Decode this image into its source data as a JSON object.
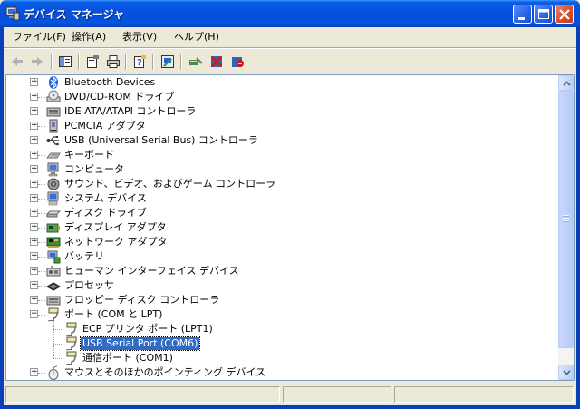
{
  "window": {
    "title": "デバイス マネージャ"
  },
  "menu": {
    "items": [
      "ファイル(F)",
      "操作(A)",
      "表示(V)",
      "ヘルプ(H)"
    ]
  },
  "toolbar": {
    "buttons": [
      "back-icon",
      "forward-icon",
      "show-hide-tree-icon",
      "properties-icon",
      "print-icon",
      "help-icon",
      "update-driver-icon",
      "scan-hardware-icon",
      "disable-device-icon",
      "uninstall-device-icon"
    ]
  },
  "tree": {
    "items": [
      {
        "label": "Bluetooth Devices",
        "icon": "bluetooth-icon",
        "expander": "+"
      },
      {
        "label": "DVD/CD-ROM ドライブ",
        "icon": "cdrom-icon",
        "expander": "+"
      },
      {
        "label": "IDE ATA/ATAPI コントローラ",
        "icon": "ide-controller-icon",
        "expander": "+"
      },
      {
        "label": "PCMCIA アダプタ",
        "icon": "pcmcia-icon",
        "expander": "+"
      },
      {
        "label": "USB (Universal Serial Bus) コントローラ",
        "icon": "usb-icon",
        "expander": "+"
      },
      {
        "label": "キーボード",
        "icon": "keyboard-icon",
        "expander": "+"
      },
      {
        "label": "コンピュータ",
        "icon": "computer-icon",
        "expander": "+"
      },
      {
        "label": "サウンド、ビデオ、およびゲーム コントローラ",
        "icon": "sound-icon",
        "expander": "+"
      },
      {
        "label": "システム デバイス",
        "icon": "system-device-icon",
        "expander": "+"
      },
      {
        "label": "ディスク ドライブ",
        "icon": "disk-drive-icon",
        "expander": "+"
      },
      {
        "label": "ディスプレイ アダプタ",
        "icon": "display-adapter-icon",
        "expander": "+"
      },
      {
        "label": "ネットワーク アダプタ",
        "icon": "network-adapter-icon",
        "expander": "+"
      },
      {
        "label": "バッテリ",
        "icon": "battery-icon",
        "expander": "+"
      },
      {
        "label": "ヒューマン インターフェイス デバイス",
        "icon": "hid-icon",
        "expander": "+"
      },
      {
        "label": "プロセッサ",
        "icon": "processor-icon",
        "expander": "+"
      },
      {
        "label": "フロッピー ディスク コントローラ",
        "icon": "floppy-controller-icon",
        "expander": "+"
      },
      {
        "label": "ポート (COM と LPT)",
        "icon": "port-icon",
        "expander": "−"
      },
      {
        "label": "ECP プリンタ ポート (LPT1)",
        "icon": "port-icon",
        "child": true
      },
      {
        "label": "USB Serial Port (COM6)",
        "icon": "port-icon",
        "child": true,
        "selected": true
      },
      {
        "label": "通信ポート (COM1)",
        "icon": "port-icon",
        "child": true
      },
      {
        "label": "マウスとそのほかのポインティング デバイス",
        "icon": "mouse-icon",
        "expander": "+"
      }
    ]
  },
  "colors": {
    "titlebar": "#0551df",
    "selection": "#316ac5",
    "face": "#ece9d8"
  }
}
